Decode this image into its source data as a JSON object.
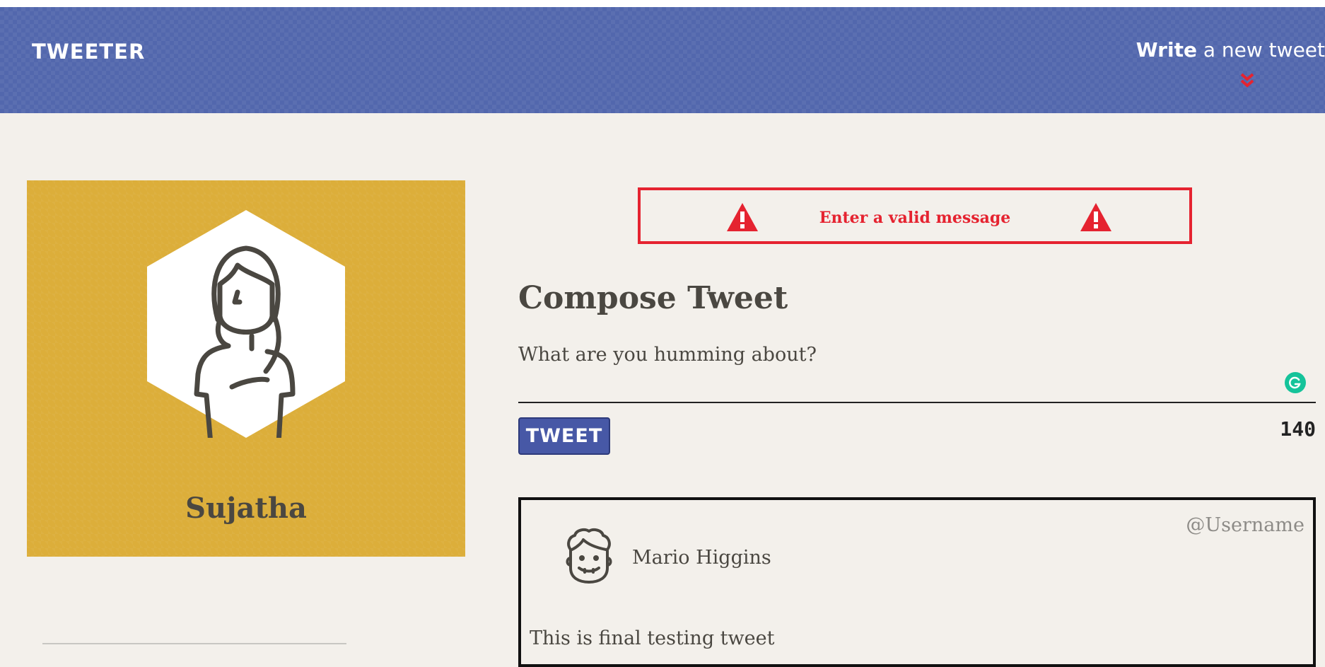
{
  "header": {
    "brand": "TWEETER",
    "write_bold": "Write",
    "write_rest": " a new tweet",
    "icons": {
      "expand": "chevron-double-down-icon"
    },
    "colors": {
      "background": "#5267ad",
      "chevron": "#e52330"
    }
  },
  "profile": {
    "name": "Sujatha",
    "avatar_icon": "woman-avatar-icon",
    "colors": {
      "card": "#dcae3a"
    }
  },
  "alert": {
    "message": "Enter a valid message",
    "icon": "warning-icon",
    "color": "#e52330"
  },
  "compose": {
    "title": "Compose Tweet",
    "placeholder": "What are you humming about?",
    "value": "",
    "tweet_button": "TWEET",
    "counter": "140",
    "grammarly_icon": "grammarly-icon"
  },
  "tweets": [
    {
      "author": "Mario Higgins",
      "handle": "@Username",
      "text": "This is final testing tweet",
      "avatar_icon": "man-avatar-icon"
    }
  ]
}
